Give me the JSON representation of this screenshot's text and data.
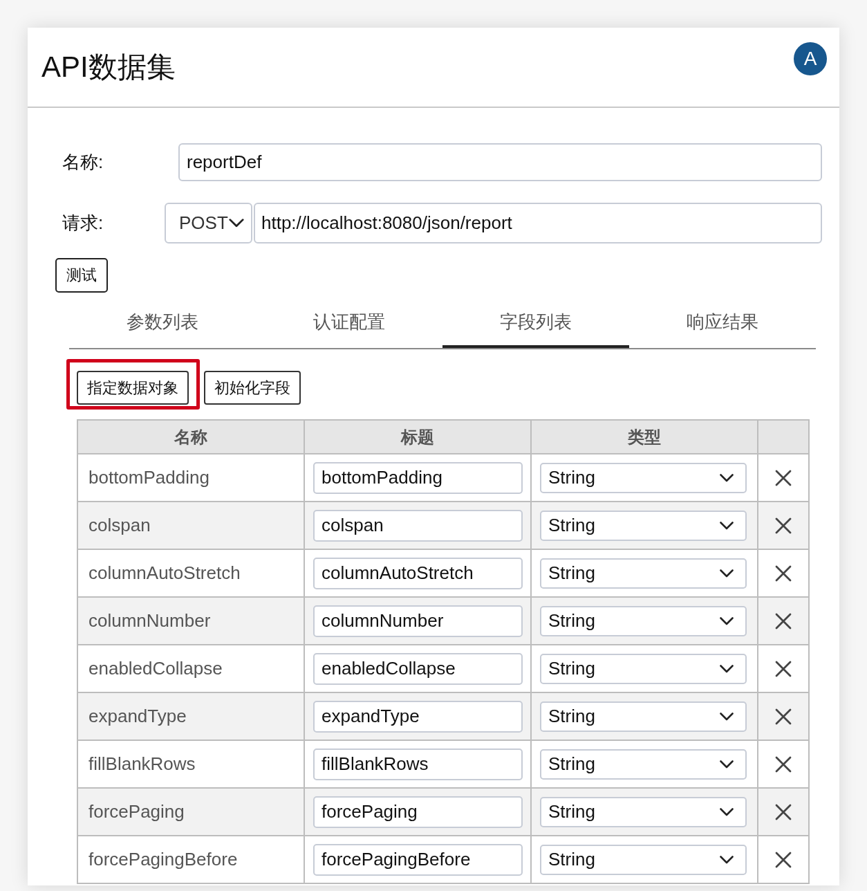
{
  "window": {
    "title": "API数据集"
  },
  "avatar": {
    "initial": "A"
  },
  "form": {
    "name_label": "名称:",
    "name_value": "reportDef",
    "request_label": "请求:",
    "method": "POST",
    "url": "http://localhost:8080/json/report",
    "test_button": "测试"
  },
  "tabs": [
    {
      "label": "参数列表",
      "selected": false
    },
    {
      "label": "认证配置",
      "selected": false
    },
    {
      "label": "字段列表",
      "selected": true
    },
    {
      "label": "响应结果",
      "selected": false
    }
  ],
  "actions": [
    {
      "label": "指定数据对象",
      "highlighted": true
    },
    {
      "label": "初始化字段",
      "highlighted": false
    }
  ],
  "table": {
    "columns": [
      "名称",
      "标题",
      "类型"
    ],
    "rows": [
      {
        "name": "bottomPadding",
        "title": "bottomPadding",
        "type": "String"
      },
      {
        "name": "colspan",
        "title": "colspan",
        "type": "String"
      },
      {
        "name": "columnAutoStretch",
        "title": "columnAutoStretch",
        "type": "String"
      },
      {
        "name": "columnNumber",
        "title": "columnNumber",
        "type": "String"
      },
      {
        "name": "enabledCollapse",
        "title": "enabledCollapse",
        "type": "String"
      },
      {
        "name": "expandType",
        "title": "expandType",
        "type": "String"
      },
      {
        "name": "fillBlankRows",
        "title": "fillBlankRows",
        "type": "String"
      },
      {
        "name": "forcePaging",
        "title": "forcePaging",
        "type": "String"
      },
      {
        "name": "forcePagingBefore",
        "title": "forcePagingBefore",
        "type": "String"
      }
    ]
  }
}
